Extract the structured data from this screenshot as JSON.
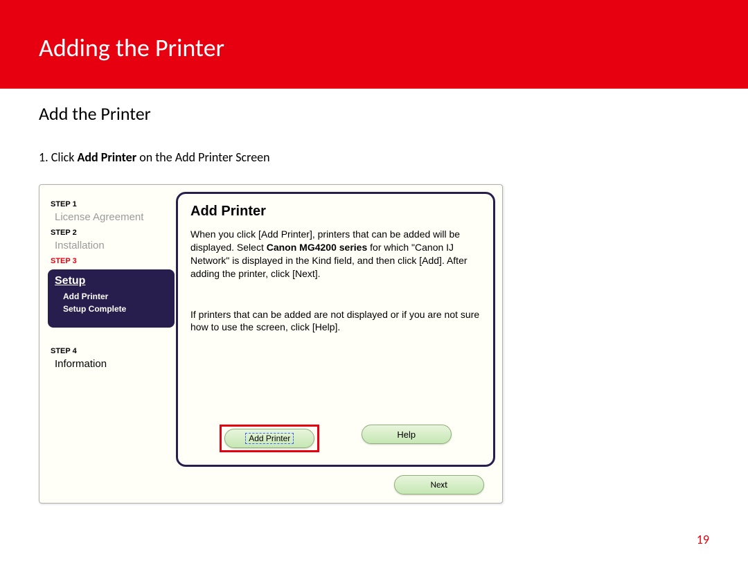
{
  "header": {
    "title": "Adding the Printer"
  },
  "section": {
    "heading": "Add the Printer",
    "instruction_prefix": "1. Click ",
    "instruction_bold": "Add Printer",
    "instruction_suffix": " on the Add Printer Screen"
  },
  "sidebar": {
    "step1_label": "STEP 1",
    "step1_title": "License Agreement",
    "step2_label": "STEP 2",
    "step2_title": "Installation",
    "step3_label": "STEP 3",
    "step3_title": "Setup",
    "step3_sub1": "Add Printer",
    "step3_sub2": "Setup Complete",
    "step4_label": "STEP 4",
    "step4_title": "Information"
  },
  "panel": {
    "title": "Add Printer",
    "text1_a": "When you click [Add Printer], printers that can be added will be displayed. Select ",
    "text1_bold": "Canon MG4200 series",
    "text1_b": " for which \"Canon IJ Network\" is displayed in the Kind field, and then click [Add]. After adding the printer, click [Next].",
    "text2": "If printers that can be added are not displayed or if you are not sure how to use the screen, click [Help].",
    "add_printer_btn": "Add Printer",
    "help_btn": "Help",
    "next_btn": "Next"
  },
  "page_number": "19"
}
